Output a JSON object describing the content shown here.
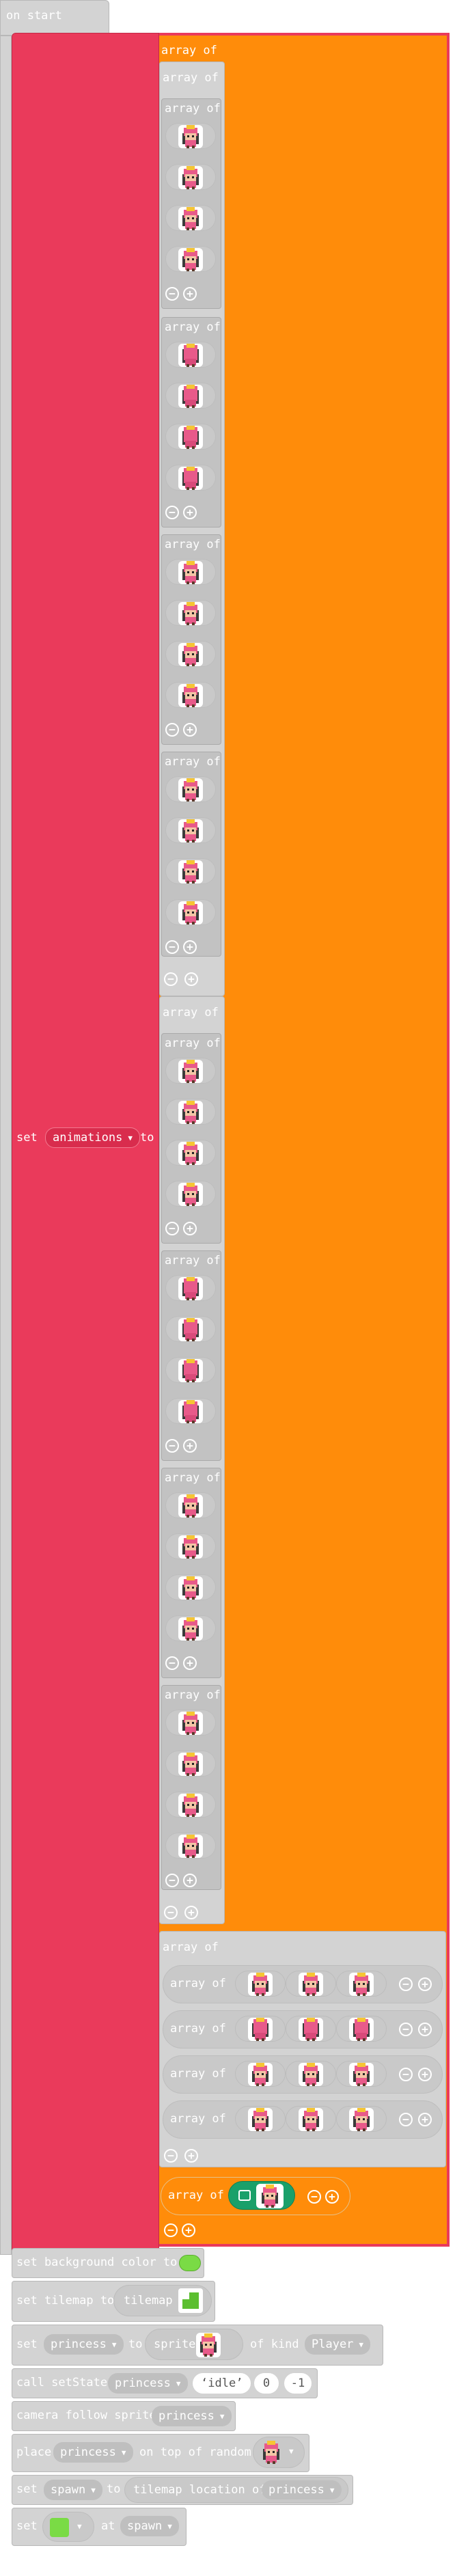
{
  "on_start": {
    "label": "on start"
  },
  "set_animations": {
    "set_label": "set",
    "variable": "animations",
    "to_label": "to",
    "array_label": "array of"
  },
  "sprite_rows": {
    "array_label": "array of"
  },
  "sprite_list": {
    "array_label": "array of"
  },
  "statements": {
    "bg": {
      "label": "set background color to",
      "color": "#7adb45"
    },
    "tilemap": {
      "label": "set tilemap to",
      "value": "tilemap"
    },
    "sprite": {
      "set": "set",
      "variable": "princess",
      "to": "to",
      "sprite": "sprite",
      "of_kind": "of kind",
      "kind": "Player"
    },
    "state": {
      "call": "call setState",
      "variable": "princess",
      "text": "idle",
      "n1": "0",
      "n2": "-1"
    },
    "camera": {
      "label": "camera follow sprite",
      "variable": "princess"
    },
    "place": {
      "label": "place",
      "variable": "princess",
      "middle": "on top of random"
    },
    "spawn": {
      "set": "set",
      "variable": "spawn",
      "to": "to",
      "tilemap_loc": "tilemap location of",
      "of_var": "princess"
    },
    "tile": {
      "set": "set",
      "at": "at",
      "variable": "spawn"
    }
  },
  "colors": {
    "red": "#ea3a5b",
    "orange": "#ff8c0a",
    "gray": "#d3d3d3",
    "green": "#1aa06a"
  },
  "icons": [
    "princess-sprite-icon",
    "plus-icon",
    "minus-icon",
    "dropdown-arrow-icon",
    "image-icon",
    "tile-icon"
  ]
}
